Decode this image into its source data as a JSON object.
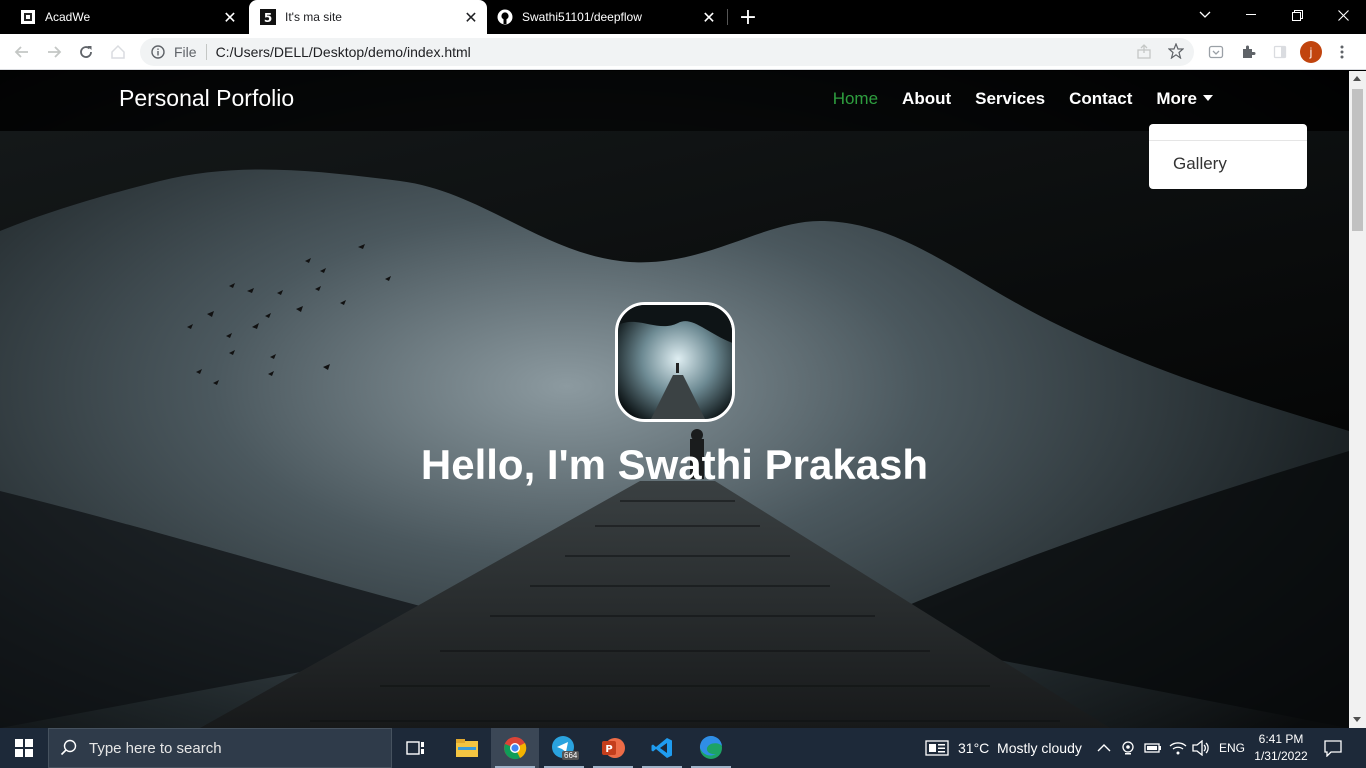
{
  "browser": {
    "tabs": [
      {
        "title": "AcadWe",
        "icon": "acadwe-favicon"
      },
      {
        "title": "It's ma site",
        "icon": "html5-favicon",
        "active": true
      },
      {
        "title": "Swathi51101/deepflow",
        "icon": "github-favicon"
      }
    ],
    "address": {
      "scheme_label": "File",
      "url": "C:/Users/DELL/Desktop/demo/index.html"
    },
    "profile_initial": "j"
  },
  "page": {
    "brand": "Personal Porfolio",
    "nav": {
      "home": "Home",
      "about": "About",
      "services": "Services",
      "contact": "Contact",
      "more": "More"
    },
    "dropdown_items": [
      "Gallery"
    ],
    "hero_title": "Hello, I'm Swathi Prakash",
    "colors": {
      "nav_active": "#2e9e3f",
      "nav_bg": "#000000"
    }
  },
  "taskbar": {
    "search_placeholder": "Type here to search",
    "telegram_badge": "664",
    "weather": "31°C  Mostly cloudy",
    "language": "ENG",
    "time": "6:41 PM",
    "date": "1/31/2022"
  }
}
